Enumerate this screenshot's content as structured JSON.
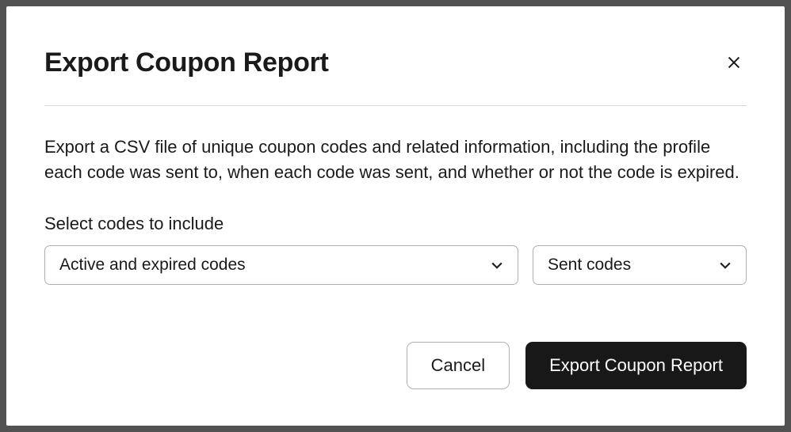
{
  "modal": {
    "title": "Export Coupon Report",
    "description": "Export a CSV file of unique coupon codes and related information, including the profile each code was sent to, when each code was sent, and whether or not the code is expired.",
    "select_label": "Select codes to include",
    "select_status": {
      "selected": "Active and expired codes"
    },
    "select_sent": {
      "selected": "Sent codes"
    },
    "actions": {
      "cancel": "Cancel",
      "export": "Export Coupon Report"
    }
  }
}
